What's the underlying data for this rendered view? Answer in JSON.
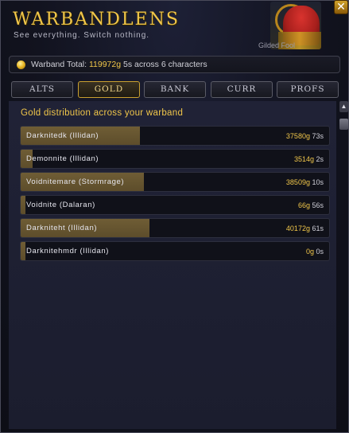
{
  "header": {
    "title": "WARBANDLENS",
    "subtitle": "See everything. Switch nothing.",
    "player_name": "Gilded Fool",
    "close_glyph": "✕"
  },
  "summary": {
    "label": "Warband Total:",
    "gold": "119972g",
    "silver_and_rest": "5s across 6 characters"
  },
  "tabs": [
    {
      "label": "ALTS",
      "active": false
    },
    {
      "label": "GOLD",
      "active": true
    },
    {
      "label": "BANK",
      "active": false
    },
    {
      "label": "CURR",
      "active": false
    },
    {
      "label": "PROFS",
      "active": false
    }
  ],
  "main": {
    "heading": "Gold distribution across your warband",
    "rows": [
      {
        "name": "Darknitedk  (Illidan)",
        "gold": "37580g",
        "silver": "73s",
        "share": 0.31
      },
      {
        "name": "Demonnite  (Illidan)",
        "gold": "3514g",
        "silver": "2s",
        "share": 0.03
      },
      {
        "name": "Voidnitemare  (Stormrage)",
        "gold": "38509g",
        "silver": "10s",
        "share": 0.32
      },
      {
        "name": "Voidnite  (Dalaran)",
        "gold": "66g",
        "silver": "56s",
        "share": 0.0
      },
      {
        "name": "Darkniteht  (Illidan)",
        "gold": "40172g",
        "silver": "61s",
        "share": 0.335
      },
      {
        "name": "Darknitehmdr  (Illidan)",
        "gold": "0g",
        "silver": "0s",
        "share": 0.0
      }
    ]
  },
  "colors": {
    "accent_gold": "#f0c64a",
    "bar_fill": "#6f5d35",
    "panel_bg": "#1b1d2e"
  },
  "icons": {
    "coin": "gold-coin-icon",
    "close": "close-icon",
    "scroll_up": "scroll-up-arrow-icon"
  }
}
